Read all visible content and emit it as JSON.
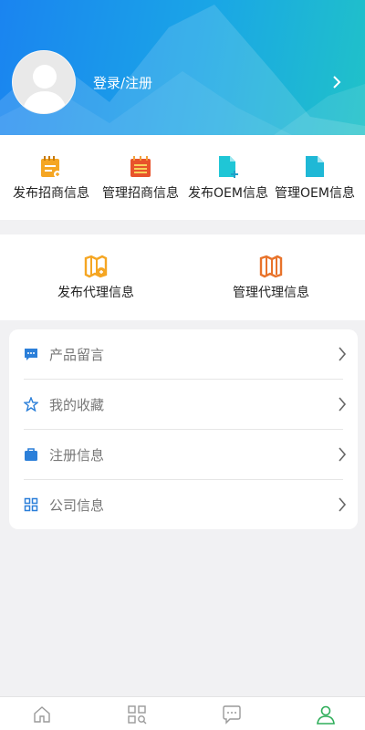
{
  "header": {
    "login_label": "登录/注册",
    "colors": {
      "gradient_start": "#1a84f0",
      "gradient_end": "#20c2c8"
    },
    "icons": {
      "avatar": "avatar-placeholder",
      "arrow": "chevron-right-icon"
    }
  },
  "grid1": {
    "items": [
      {
        "label": "发布招商信息",
        "icon": "publish-recruit-icon",
        "color": "#f5a623"
      },
      {
        "label": "管理招商信息",
        "icon": "manage-recruit-icon",
        "color": "#e8532b"
      },
      {
        "label": "发布OEM信息",
        "icon": "publish-oem-icon",
        "color": "#1fc6d6"
      },
      {
        "label": "管理OEM信息",
        "icon": "manage-oem-icon",
        "color": "#1fb8d6"
      }
    ]
  },
  "grid2": {
    "items": [
      {
        "label": "发布代理信息",
        "icon": "publish-agent-map-icon",
        "color": "#f5a623"
      },
      {
        "label": "管理代理信息",
        "icon": "manage-agent-map-icon",
        "color": "#e8732b"
      }
    ]
  },
  "menu": {
    "items": [
      {
        "label": "产品留言",
        "icon": "message-icon"
      },
      {
        "label": "我的收藏",
        "icon": "star-icon"
      },
      {
        "label": "注册信息",
        "icon": "briefcase-icon"
      },
      {
        "label": "公司信息",
        "icon": "grid-icon"
      }
    ],
    "accent": "#2b7fd9"
  },
  "tabbar": {
    "tabs": [
      {
        "icon": "home-icon",
        "active": false
      },
      {
        "icon": "category-icon",
        "active": false
      },
      {
        "icon": "chat-icon",
        "active": false
      },
      {
        "icon": "user-icon",
        "active": true
      }
    ],
    "active_color": "#2fae5a"
  }
}
